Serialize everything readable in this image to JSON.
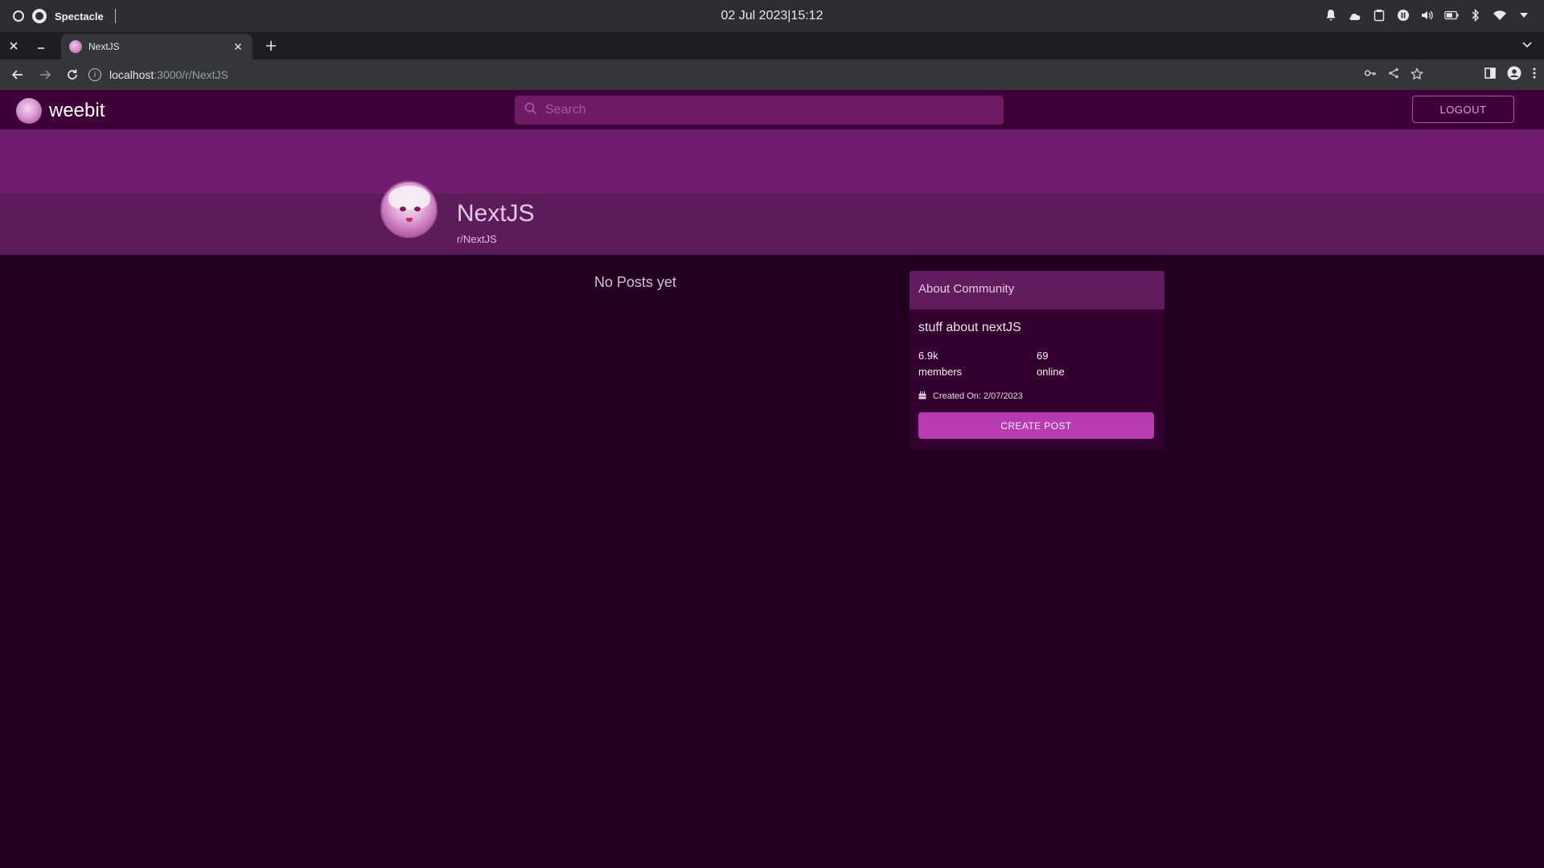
{
  "os": {
    "app_name": "Spectacle",
    "clock": "02 Jul 2023|15:12"
  },
  "browser": {
    "tab_title": "NextJS",
    "url_host": "localhost",
    "url_path": ":3000/r/NextJS"
  },
  "app": {
    "brand": "weebit",
    "search_placeholder": "Search",
    "logout_label": "LOGOUT"
  },
  "subreddit": {
    "name": "NextJS",
    "handle": "r/NextJS"
  },
  "feed": {
    "empty_text": "No Posts yet"
  },
  "about": {
    "title": "About Community",
    "description": "stuff about nextJS",
    "members_count": "6.9k",
    "members_label": "members",
    "online_count": "69",
    "online_label": "online",
    "created": "Created On: 2/07/2023",
    "create_post_label": "CREATE POST"
  },
  "colors": {
    "page_bg": "#210020",
    "header_bg": "#3d0039",
    "banner": "#721c70",
    "subheader": "#5c1c5b",
    "accent": "#b93bb1"
  }
}
